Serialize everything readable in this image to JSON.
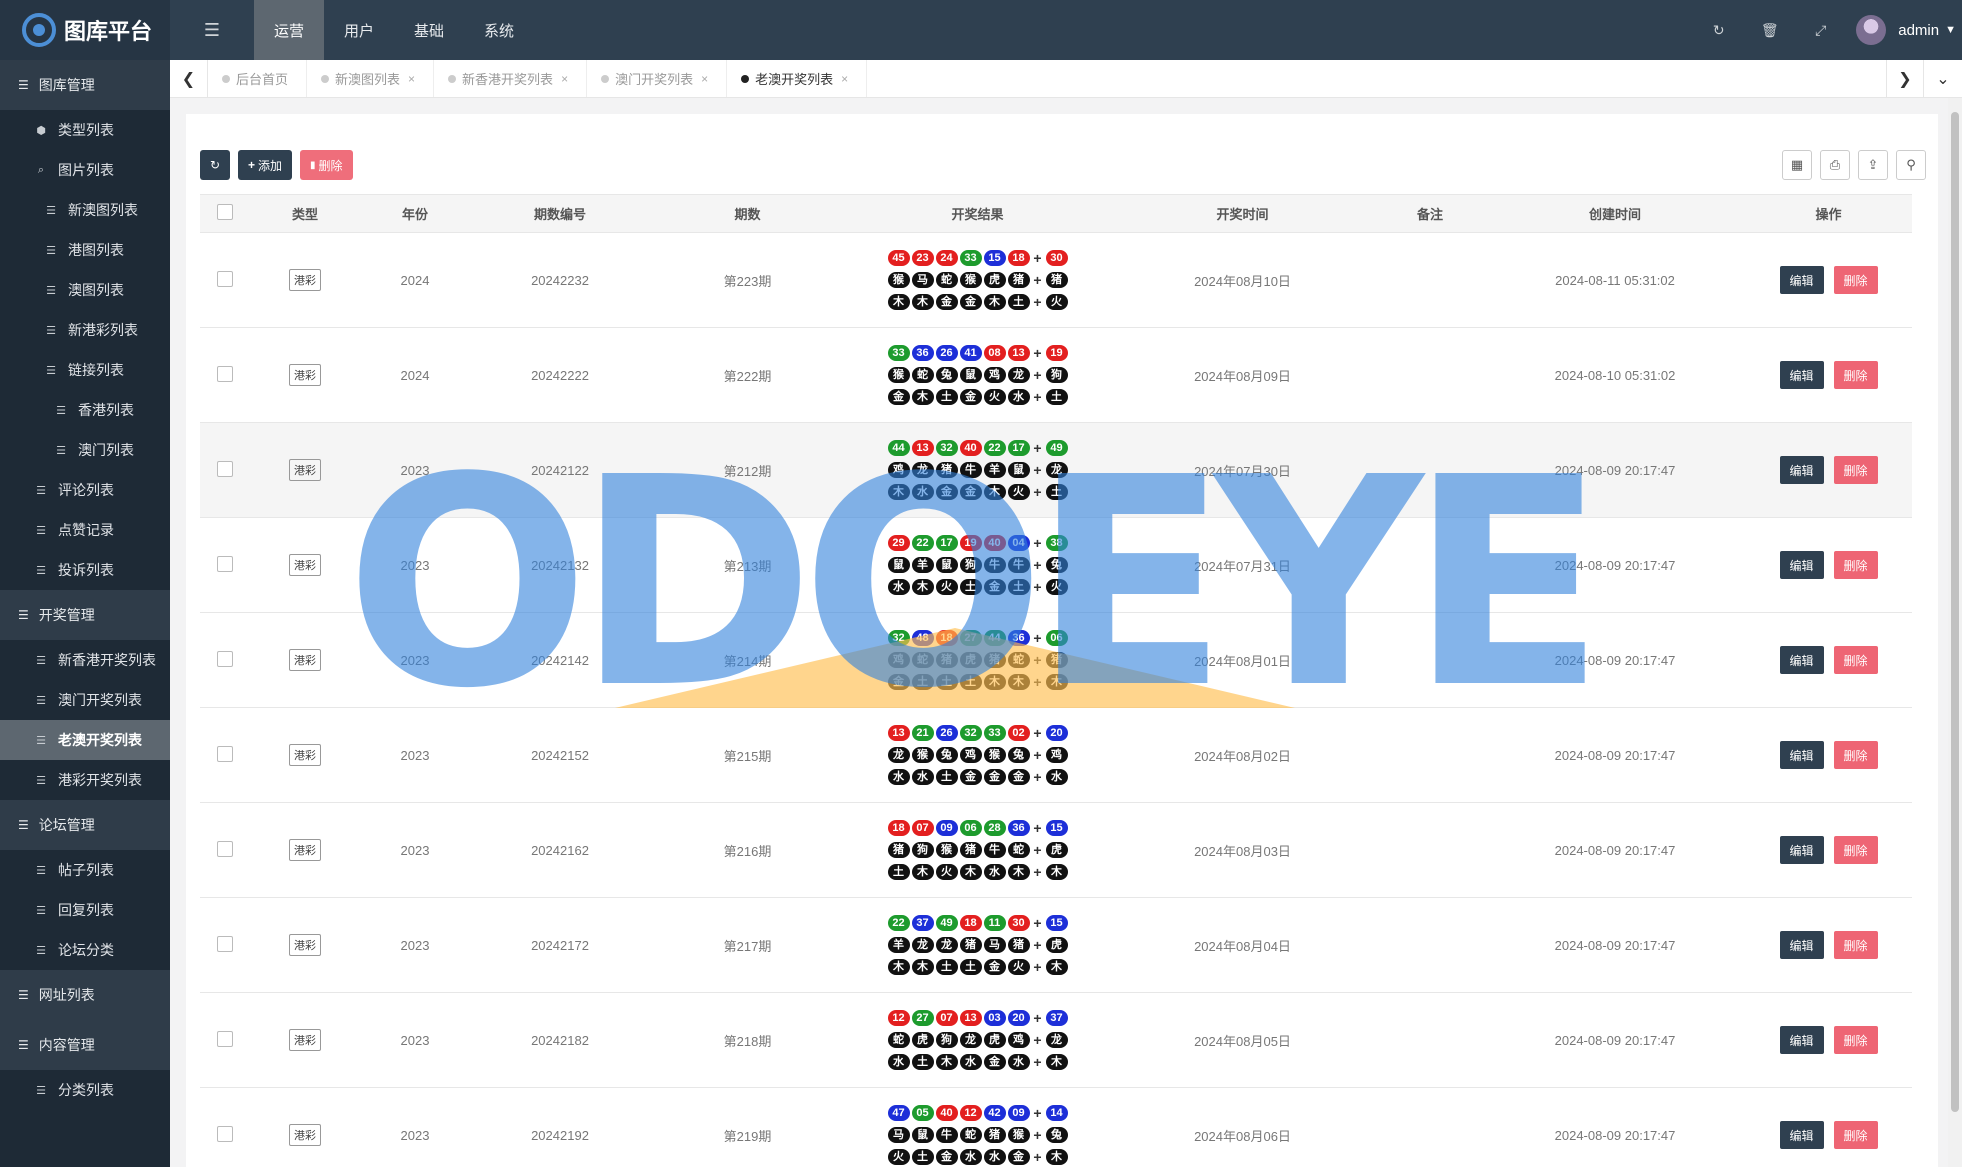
{
  "app": {
    "title": "图库平台"
  },
  "topnav": [
    "运营",
    "用户",
    "基础",
    "系统"
  ],
  "user": {
    "name": "admin"
  },
  "sidebar": [
    {
      "kind": "group",
      "label": "图库管理",
      "icon": "list-icon"
    },
    {
      "kind": "item",
      "label": "类型列表",
      "indent": 1,
      "icon": "cube-icon"
    },
    {
      "kind": "item",
      "label": "图片列表",
      "indent": 1,
      "icon": "search-icon"
    },
    {
      "kind": "item",
      "label": "新澳图列表",
      "indent": 2,
      "icon": "list-icon"
    },
    {
      "kind": "item",
      "label": "港图列表",
      "indent": 2,
      "icon": "list-icon"
    },
    {
      "kind": "item",
      "label": "澳图列表",
      "indent": 2,
      "icon": "list-icon"
    },
    {
      "kind": "item",
      "label": "新港彩列表",
      "indent": 2,
      "icon": "list-icon"
    },
    {
      "kind": "item",
      "label": "链接列表",
      "indent": 2,
      "icon": "list-icon"
    },
    {
      "kind": "item",
      "label": "香港列表",
      "indent": 3,
      "icon": "list-icon"
    },
    {
      "kind": "item",
      "label": "澳门列表",
      "indent": 3,
      "icon": "list-icon"
    },
    {
      "kind": "item",
      "label": "评论列表",
      "indent": 1,
      "icon": "list-icon"
    },
    {
      "kind": "item",
      "label": "点赞记录",
      "indent": 1,
      "icon": "list-icon"
    },
    {
      "kind": "item",
      "label": "投诉列表",
      "indent": 1,
      "icon": "list-icon"
    },
    {
      "kind": "group",
      "label": "开奖管理",
      "icon": "list-icon"
    },
    {
      "kind": "item",
      "label": "新香港开奖列表",
      "indent": 1,
      "icon": "list-icon"
    },
    {
      "kind": "item",
      "label": "澳门开奖列表",
      "indent": 1,
      "icon": "list-icon"
    },
    {
      "kind": "item",
      "label": "老澳开奖列表",
      "indent": 1,
      "icon": "list-icon",
      "active": true
    },
    {
      "kind": "item",
      "label": "港彩开奖列表",
      "indent": 1,
      "icon": "list-icon"
    },
    {
      "kind": "group",
      "label": "论坛管理",
      "icon": "list-icon"
    },
    {
      "kind": "item",
      "label": "帖子列表",
      "indent": 1,
      "icon": "list-icon"
    },
    {
      "kind": "item",
      "label": "回复列表",
      "indent": 1,
      "icon": "list-icon"
    },
    {
      "kind": "item",
      "label": "论坛分类",
      "indent": 1,
      "icon": "list-icon"
    },
    {
      "kind": "group",
      "label": "网址列表",
      "icon": "list-icon"
    },
    {
      "kind": "group",
      "label": "内容管理",
      "icon": "list-icon"
    },
    {
      "kind": "item",
      "label": "分类列表",
      "indent": 1,
      "icon": "list-icon"
    }
  ],
  "tabs": [
    {
      "label": "后台首页",
      "closable": false,
      "active": false
    },
    {
      "label": "新澳图列表",
      "closable": true,
      "active": false
    },
    {
      "label": "新香港开奖列表",
      "closable": true,
      "active": false
    },
    {
      "label": "澳门开奖列表",
      "closable": true,
      "active": false
    },
    {
      "label": "老澳开奖列表",
      "closable": true,
      "active": true
    }
  ],
  "toolbar": {
    "add_label": "添加",
    "delete_label": "删除"
  },
  "table": {
    "columns": [
      "类型",
      "年份",
      "期数编号",
      "期数",
      "开奖结果",
      "开奖时间",
      "备注",
      "创建时间",
      "操作"
    ],
    "edit_label": "编辑",
    "delete_label": "删除",
    "rows": [
      {
        "type": "港彩",
        "year": "2024",
        "code": "20242232",
        "issue": "第223期",
        "time": "2024年08月10日",
        "note": "",
        "created": "2024-08-11 05:31:02",
        "nums": [
          "45",
          "23",
          "24",
          "33",
          "15",
          "18",
          "30"
        ],
        "colors": [
          "red",
          "red",
          "red",
          "green",
          "blue",
          "red",
          "red"
        ],
        "zodiac": [
          "猴",
          "马",
          "蛇",
          "猴",
          "虎",
          "猪",
          "猪"
        ],
        "elements": [
          "木",
          "木",
          "金",
          "金",
          "木",
          "土",
          "火"
        ]
      },
      {
        "type": "港彩",
        "year": "2024",
        "code": "20242222",
        "issue": "第222期",
        "time": "2024年08月09日",
        "note": "",
        "created": "2024-08-10 05:31:02",
        "nums": [
          "33",
          "36",
          "26",
          "41",
          "08",
          "13",
          "19"
        ],
        "colors": [
          "green",
          "blue",
          "blue",
          "blue",
          "red",
          "red",
          "red"
        ],
        "zodiac": [
          "猴",
          "蛇",
          "兔",
          "鼠",
          "鸡",
          "龙",
          "狗"
        ],
        "elements": [
          "金",
          "木",
          "土",
          "金",
          "火",
          "水",
          "土"
        ]
      },
      {
        "type": "港彩",
        "year": "2023",
        "code": "20242122",
        "issue": "第212期",
        "time": "2024年07月30日",
        "note": "",
        "created": "2024-08-09 20:17:47",
        "hl": true,
        "nums": [
          "44",
          "13",
          "32",
          "40",
          "22",
          "17",
          "49"
        ],
        "colors": [
          "green",
          "red",
          "green",
          "red",
          "green",
          "green",
          "green"
        ],
        "zodiac": [
          "鸡",
          "龙",
          "猪",
          "牛",
          "羊",
          "鼠",
          "龙"
        ],
        "elements": [
          "木",
          "水",
          "金",
          "金",
          "木",
          "火",
          "土"
        ]
      },
      {
        "type": "港彩",
        "year": "2023",
        "code": "20242132",
        "issue": "第213期",
        "time": "2024年07月31日",
        "note": "",
        "created": "2024-08-09 20:17:47",
        "nums": [
          "29",
          "22",
          "17",
          "19",
          "40",
          "04",
          "38"
        ],
        "colors": [
          "red",
          "green",
          "green",
          "red",
          "red",
          "blue",
          "green"
        ],
        "zodiac": [
          "鼠",
          "羊",
          "鼠",
          "狗",
          "牛",
          "牛",
          "兔"
        ],
        "elements": [
          "水",
          "木",
          "火",
          "土",
          "金",
          "土",
          "火"
        ]
      },
      {
        "type": "港彩",
        "year": "2023",
        "code": "20242142",
        "issue": "第214期",
        "time": "2024年08月01日",
        "note": "",
        "created": "2024-08-09 20:17:47",
        "nums": [
          "32",
          "48",
          "18",
          "27",
          "44",
          "36",
          "06"
        ],
        "colors": [
          "green",
          "blue",
          "red",
          "green",
          "green",
          "blue",
          "green"
        ],
        "zodiac": [
          "鸡",
          "蛇",
          "猪",
          "虎",
          "猪",
          "蛇",
          "猪"
        ],
        "elements": [
          "金",
          "土",
          "土",
          "土",
          "木",
          "木",
          "木"
        ]
      },
      {
        "type": "港彩",
        "year": "2023",
        "code": "20242152",
        "issue": "第215期",
        "time": "2024年08月02日",
        "note": "",
        "created": "2024-08-09 20:17:47",
        "nums": [
          "13",
          "21",
          "26",
          "32",
          "33",
          "02",
          "20"
        ],
        "colors": [
          "red",
          "green",
          "blue",
          "green",
          "green",
          "red",
          "blue"
        ],
        "zodiac": [
          "龙",
          "猴",
          "兔",
          "鸡",
          "猴",
          "兔",
          "鸡"
        ],
        "elements": [
          "水",
          "水",
          "土",
          "金",
          "金",
          "金",
          "水"
        ]
      },
      {
        "type": "港彩",
        "year": "2023",
        "code": "20242162",
        "issue": "第216期",
        "time": "2024年08月03日",
        "note": "",
        "created": "2024-08-09 20:17:47",
        "nums": [
          "18",
          "07",
          "09",
          "06",
          "28",
          "36",
          "15"
        ],
        "colors": [
          "red",
          "red",
          "blue",
          "green",
          "green",
          "blue",
          "blue"
        ],
        "zodiac": [
          "猪",
          "狗",
          "猴",
          "猪",
          "牛",
          "蛇",
          "虎"
        ],
        "elements": [
          "土",
          "木",
          "火",
          "木",
          "水",
          "木",
          "木"
        ]
      },
      {
        "type": "港彩",
        "year": "2023",
        "code": "20242172",
        "issue": "第217期",
        "time": "2024年08月04日",
        "note": "",
        "created": "2024-08-09 20:17:47",
        "nums": [
          "22",
          "37",
          "49",
          "18",
          "11",
          "30",
          "15"
        ],
        "colors": [
          "green",
          "blue",
          "green",
          "red",
          "green",
          "red",
          "blue"
        ],
        "zodiac": [
          "羊",
          "龙",
          "龙",
          "猪",
          "马",
          "猪",
          "虎"
        ],
        "elements": [
          "木",
          "木",
          "土",
          "土",
          "金",
          "火",
          "木"
        ]
      },
      {
        "type": "港彩",
        "year": "2023",
        "code": "20242182",
        "issue": "第218期",
        "time": "2024年08月05日",
        "note": "",
        "created": "2024-08-09 20:17:47",
        "nums": [
          "12",
          "27",
          "07",
          "13",
          "03",
          "20",
          "37"
        ],
        "colors": [
          "red",
          "green",
          "red",
          "red",
          "blue",
          "blue",
          "blue"
        ],
        "zodiac": [
          "蛇",
          "虎",
          "狗",
          "龙",
          "虎",
          "鸡",
          "龙"
        ],
        "elements": [
          "水",
          "土",
          "木",
          "水",
          "金",
          "水",
          "木"
        ]
      },
      {
        "type": "港彩",
        "year": "2023",
        "code": "20242192",
        "issue": "第219期",
        "time": "2024年08月06日",
        "note": "",
        "created": "2024-08-09 20:17:47",
        "nums": [
          "47",
          "05",
          "40",
          "12",
          "42",
          "09",
          "14"
        ],
        "colors": [
          "blue",
          "green",
          "red",
          "red",
          "blue",
          "blue",
          "blue"
        ],
        "zodiac": [
          "马",
          "鼠",
          "牛",
          "蛇",
          "猪",
          "猴",
          "兔"
        ],
        "elements": [
          "火",
          "土",
          "金",
          "水",
          "水",
          "金",
          "木"
        ]
      }
    ]
  },
  "watermark": {
    "text": "ODOEYE"
  },
  "colors": {
    "topbar": "#2f4050",
    "sidebar": "#1e2a36",
    "active": "#5d6770",
    "danger": "#ed5565",
    "ball_red": "#e31f1f",
    "ball_green": "#1d9b2d",
    "ball_blue": "#1d2fd8"
  }
}
